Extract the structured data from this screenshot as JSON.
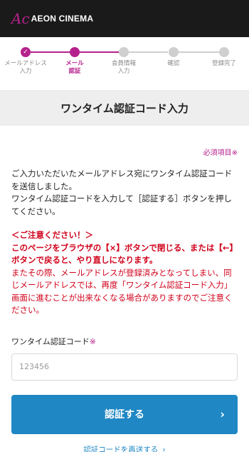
{
  "header": {
    "logo_mark": "Ac",
    "logo_text": "AEON CINEMA"
  },
  "steps": [
    {
      "label": "メールアドレス\n入力",
      "state": "done"
    },
    {
      "label": "メール\n認証",
      "state": "current"
    },
    {
      "label": "会員情報\n入力",
      "state": "todo"
    },
    {
      "label": "確認",
      "state": "todo"
    },
    {
      "label": "登録完了",
      "state": "todo"
    }
  ],
  "check_glyph": "✓",
  "page_title": "ワンタイム認証コード入力",
  "required_note": "必須項目※",
  "description": "ご入力いただいたメールアドレス宛にワンタイム認証コードを送信しました。\nワンタイム認証コードを入力して［認証する］ボタンを押してください。",
  "warning": {
    "heading": "＜ご注意ください！＞",
    "bold_text": "このページをブラウザの【×】ボタンで閉じる、または【←】ボタンで戻ると、やり直しになります。",
    "body": "またその際、メールアドレスが登録済みとなってしまい、同じメールアドレスでは、再度「ワンタイム認証コード入力」画面に進むことが出来なくなる場合がありますのでご注意ください。"
  },
  "field": {
    "label": "ワンタイム認証コード",
    "asterisk": "※",
    "placeholder": "123456",
    "value": ""
  },
  "submit": {
    "label": "認証する",
    "chevron": "›"
  },
  "resend": {
    "label": "認証コードを再送する",
    "chevron": "›"
  },
  "colors": {
    "accent": "#b5218c",
    "button": "#1f87c4",
    "warning": "#d0021b",
    "header_bg": "#1a1a1a"
  }
}
